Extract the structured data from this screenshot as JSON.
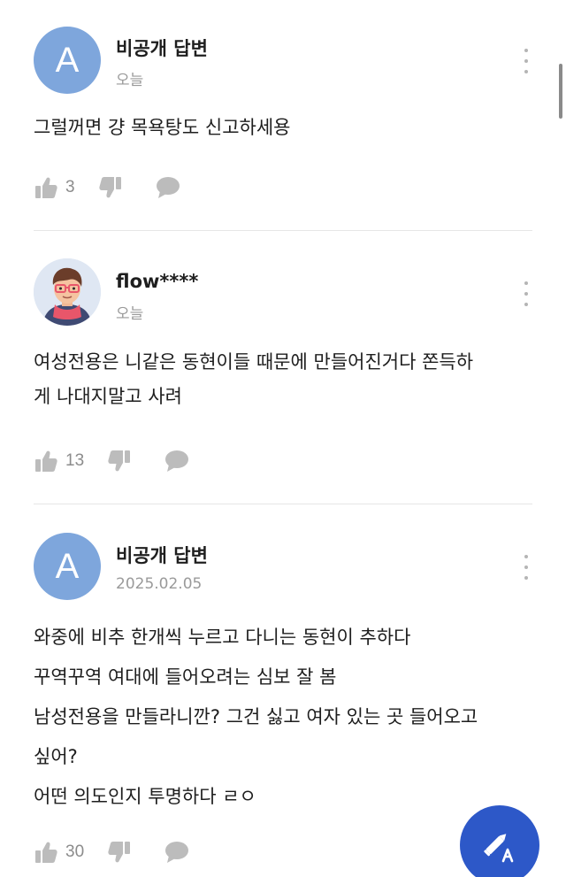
{
  "answers": [
    {
      "author": "비공개 답변",
      "avatar_letter": "A",
      "date": "오늘",
      "lines": [
        "그럴꺼면 걍 목욕탕도 신고하세용"
      ],
      "likes": "3"
    },
    {
      "author": "flow****",
      "avatar_letter": "",
      "date": "오늘",
      "lines": [
        "여성전용은 니같은 동현이들 때문에 만들어진거다 쫀득하",
        "게 나대지말고 사려"
      ],
      "likes": "13"
    },
    {
      "author": "비공개 답변",
      "avatar_letter": "A",
      "date": "2025.02.05",
      "lines": [
        "와중에 비추 한개씩 누르고 다니는 동현이 추하다",
        "꾸역꾸역 여대에 들어오려는 심보 잘 봄",
        "남성전용을 만들라니깐? 그건 싫고 여자 있는 곳 들어오고",
        "싶어?",
        "어떤 의도인지 투명하다 ㄹㅇ"
      ],
      "likes": "30"
    }
  ],
  "icons": {
    "like": "thumbs-up-icon",
    "dislike": "thumbs-down-icon",
    "comment": "comment-icon",
    "more": "more-vertical-icon",
    "write": "write-answer-icon"
  },
  "colors": {
    "avatar_blue": "#7ea6dc",
    "fab_blue": "#2d58c8",
    "icon_gray": "#bcbcbc",
    "meta_gray": "#9a9a9a"
  }
}
